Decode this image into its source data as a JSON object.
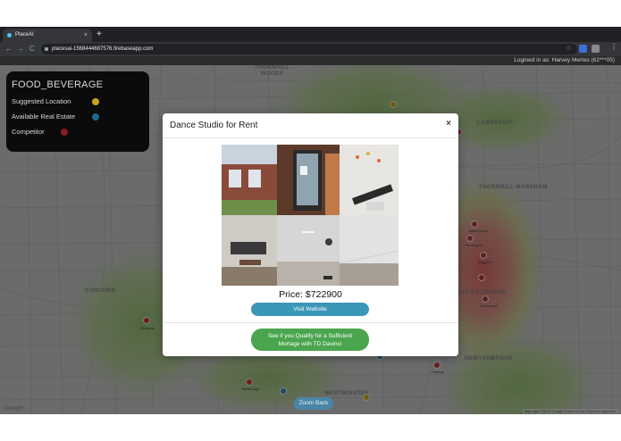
{
  "browser": {
    "tab_title": "PlaceAI",
    "tab_close": "×",
    "new_tab": "+",
    "back": "←",
    "forward": "→",
    "reload": "C",
    "url": "placesai-1568444687576.firebaseapp.com",
    "bookmark_star": "☆",
    "menu": "⋮"
  },
  "session": {
    "logged_in_text": "Logined in as: Harvey Mertes (62***05)"
  },
  "map": {
    "labels": {
      "thornhill_woods": "THORNHILL\nWOODS",
      "langstaff": "LANGSTAFF",
      "thornhill_markham": "THORNHILL-MARKHAM",
      "concord": "CONCORD",
      "corners": "ELES CORNERS",
      "newtonbrook": "NEWTONBROOK",
      "westminster": "WESTMINSTER"
    },
    "marker_labels": [
      "Sobebourne",
      "Flemington",
      "Baggerie",
      "Gravesend",
      "Elmhurst",
      "Fairway",
      "Bainbridge"
    ],
    "zoom_back_label": "Zoom Back",
    "google": "Google",
    "attribution": "Map data ©2019 Google   Terms of Use   Report a map error"
  },
  "legend": {
    "title": "FOOD_BEVERAGE",
    "items": [
      {
        "label": "Suggested Location",
        "color": "#c9a21b"
      },
      {
        "label": "Available Real Estate",
        "color": "#1d6a8c"
      },
      {
        "label": "Competitor",
        "color": "#8a1c24"
      }
    ]
  },
  "modal": {
    "title": "Dance Studio for Rent",
    "close": "×",
    "price": "Price: $722900",
    "visit_button": "Visit Website",
    "qualify_button_line1": "See if you Qualify for a Sufficient",
    "qualify_button_line2": "Mortage with TD Davinci"
  },
  "colors": {
    "suggested": "#e0b41e",
    "real_estate": "#3d8fc0",
    "competitor": "#d43a3a",
    "visit_button": "#3a97b7",
    "qualify_button": "#4aa54e"
  }
}
